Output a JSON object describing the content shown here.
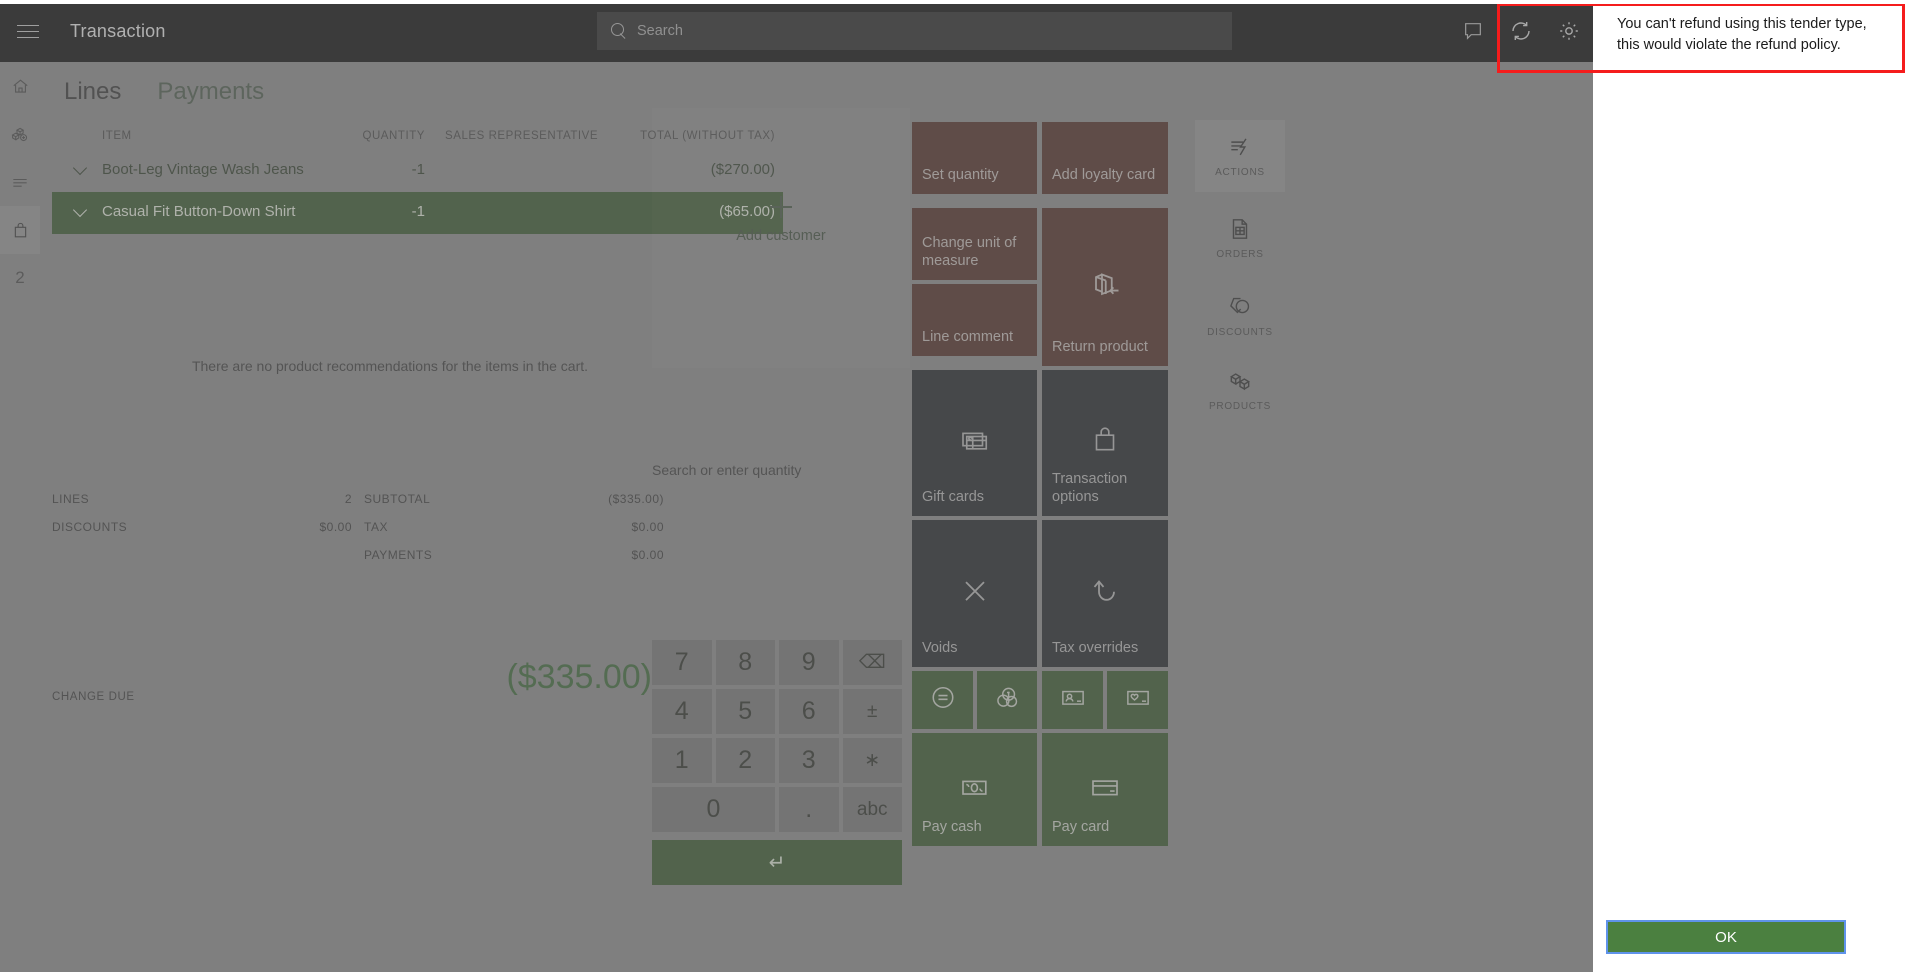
{
  "header": {
    "title": "Transaction",
    "search_placeholder": "Search",
    "menu_icon": "hamburger-icon",
    "icons": [
      "feedback-icon",
      "sync-icon",
      "settings-gear-icon"
    ]
  },
  "leftnav": {
    "items": [
      {
        "icon": "home-icon",
        "name": "home"
      },
      {
        "icon": "inventory-boxes-icon",
        "name": "inventory"
      },
      {
        "icon": "list-lines-icon",
        "name": "lines"
      },
      {
        "icon": "shopping-bag-icon",
        "name": "cart",
        "active": true
      }
    ],
    "badge_count": "2"
  },
  "cart": {
    "tabs": [
      {
        "label": "Lines",
        "active": true
      },
      {
        "label": "Payments",
        "active": false
      }
    ],
    "columns": {
      "item": "ITEM",
      "quantity": "QUANTITY",
      "sales_representative": "SALES REPRESENTATIVE",
      "total": "TOTAL (WITHOUT TAX)"
    },
    "rows": [
      {
        "item": "Boot-Leg Vintage Wash Jeans",
        "quantity": "-1",
        "rep": "",
        "total": "($270.00)",
        "selected": false
      },
      {
        "item": "Casual Fit Button-Down Shirt",
        "quantity": "-1",
        "rep": "",
        "total": "($65.00)",
        "selected": true
      }
    ],
    "no_recommendations": "There are no product recommendations for the items in the cart.",
    "totals": {
      "lines_label": "LINES",
      "lines_value": "2",
      "discounts_label": "DISCOUNTS",
      "discounts_value": "$0.00",
      "subtotal_label": "SUBTOTAL",
      "subtotal_value": "($335.00)",
      "tax_label": "TAX",
      "tax_value": "$0.00",
      "payments_label": "PAYMENTS",
      "payments_value": "$0.00"
    },
    "change_due_label": "CHANGE DUE",
    "change_due_value": "($335.00)"
  },
  "customer": {
    "add_label": "Add customer",
    "quantity_placeholder": "Search or enter quantity"
  },
  "keypad": {
    "keys": [
      "7",
      "8",
      "9",
      "⌫",
      "4",
      "5",
      "6",
      "±",
      "1",
      "2",
      "3",
      "∗",
      "0",
      ".",
      "abc"
    ],
    "enter": "↵"
  },
  "tiles": [
    {
      "label": "Set quantity",
      "style": "red",
      "icon": null
    },
    {
      "label": "Add loyalty card",
      "style": "red",
      "icon": null
    },
    {
      "label": "Change unit of measure",
      "style": "red",
      "icon": null
    },
    {
      "label": "Return product",
      "style": "red",
      "icon": "return-product-icon"
    },
    {
      "label": "Line comment",
      "style": "red",
      "icon": null
    },
    {
      "label": "Gift cards",
      "style": "dark",
      "icon": "gift-card-icon"
    },
    {
      "label": "Transaction options",
      "style": "dark",
      "icon": "shopping-bag-icon"
    },
    {
      "label": "Voids",
      "style": "dark",
      "icon": "close-x-icon"
    },
    {
      "label": "Tax overrides",
      "style": "dark",
      "icon": "undo-arrow-icon"
    },
    {
      "label": "",
      "style": "green",
      "icon": "equals-circle-icon"
    },
    {
      "label": "",
      "style": "green",
      "icon": "currency-coins-icon"
    },
    {
      "label": "",
      "style": "green",
      "icon": "id-card-icon"
    },
    {
      "label": "",
      "style": "green",
      "icon": "gift-card-heart-icon"
    },
    {
      "label": "Pay cash",
      "style": "green",
      "icon": "cash-bill-icon"
    },
    {
      "label": "Pay card",
      "style": "green",
      "icon": "credit-card-icon"
    }
  ],
  "rail": [
    {
      "label": "ACTIONS",
      "icon": "actions-lightning-icon",
      "active": true
    },
    {
      "label": "ORDERS",
      "icon": "orders-document-icon",
      "active": false
    },
    {
      "label": "DISCOUNTS",
      "icon": "discount-tag-icon",
      "active": false
    },
    {
      "label": "PRODUCTS",
      "icon": "products-cubes-icon",
      "active": false
    }
  ],
  "dialog": {
    "message": "You can't refund using this tender type, this would violate the refund policy.",
    "ok_label": "OK"
  },
  "colors": {
    "accent_green": "#2b4a21",
    "tile_red": "#432019",
    "tile_dark": "#15181c",
    "canvas_grey": "#7f7f7f",
    "topbar_black": "#000000",
    "highlight_red": "#f51c1c",
    "ok_button_green": "#4b8040",
    "focus_blue": "#5f93ea"
  }
}
